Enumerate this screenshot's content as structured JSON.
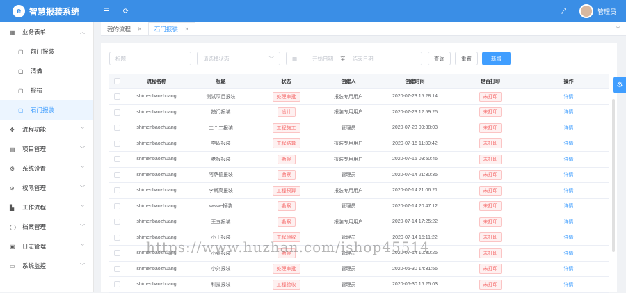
{
  "app": {
    "title": "智慧报装系统",
    "logo_letter": "e",
    "user_name": "管理员"
  },
  "topbar_icons": [
    "menu-icon",
    "refresh-icon",
    "fullscreen-icon"
  ],
  "sidebar": [
    {
      "label": "业务表单",
      "icon": "grid-icon",
      "expanded": true,
      "children": [
        {
          "label": "前门报装",
          "active": false
        },
        {
          "label": "清做",
          "active": false
        },
        {
          "label": "报损",
          "active": false
        },
        {
          "label": "石门报装",
          "active": true
        }
      ]
    },
    {
      "label": "流程功能",
      "icon": "flow-icon"
    },
    {
      "label": "项目管理",
      "icon": "project-icon"
    },
    {
      "label": "系统设置",
      "icon": "gear-icon"
    },
    {
      "label": "权限管理",
      "icon": "shield-icon"
    },
    {
      "label": "工作流程",
      "icon": "workflow-icon"
    },
    {
      "label": "档案管理",
      "icon": "archive-icon"
    },
    {
      "label": "日志管理",
      "icon": "log-icon"
    },
    {
      "label": "系统监控",
      "icon": "monitor-icon"
    }
  ],
  "tabs": [
    {
      "label": "我的流程",
      "active": false
    },
    {
      "label": "石门报装",
      "active": true
    }
  ],
  "filters": {
    "keyword_placeholder": "标题",
    "status_placeholder": "请选择状态",
    "date_start_placeholder": "开始日期",
    "date_sep": "至",
    "date_end_placeholder": "结束日期",
    "search_label": "查询",
    "reset_label": "重置",
    "add_label": "新增"
  },
  "table": {
    "headers": [
      "流程名称",
      "标题",
      "状态",
      "创建人",
      "创建时间",
      "是否打印",
      "操作"
    ],
    "rows": [
      {
        "flow": "shimenbaozhuang",
        "title": "测试项目报装",
        "status": "处理审批",
        "creator": "报装专用用户",
        "time": "2020-07-23 15:28:14",
        "print": "未打印",
        "op": "详情"
      },
      {
        "flow": "shimenbaozhuang",
        "title": "技门报装",
        "status": "设计",
        "creator": "报装专用用户",
        "time": "2020-07-23 12:59:25",
        "print": "未打印",
        "op": "详情"
      },
      {
        "flow": "shimenbaozhuang",
        "title": "工个二报装",
        "status": "工程施工",
        "creator": "管理员",
        "time": "2020-07-23 09:38:03",
        "print": "未打印",
        "op": "详情"
      },
      {
        "flow": "shimenbaozhuang",
        "title": "李四报装",
        "status": "工程结算",
        "creator": "报装专用用户",
        "time": "2020-07-15 11:30:42",
        "print": "未打印",
        "op": "详情"
      },
      {
        "flow": "shimenbaozhuang",
        "title": "老板报装",
        "status": "勘察",
        "creator": "报装专用用户",
        "time": "2020-07-15 09:50:46",
        "print": "未打印",
        "op": "详情"
      },
      {
        "flow": "shimenbaozhuang",
        "title": "阿萨德报装",
        "status": "勘察",
        "creator": "管理员",
        "time": "2020-07-14 21:30:35",
        "print": "未打印",
        "op": "详情"
      },
      {
        "flow": "shimenbaozhuang",
        "title": "李斯高报装",
        "status": "工程预算",
        "creator": "报装专用用户",
        "time": "2020-07-14 21:06:21",
        "print": "未打印",
        "op": "详情"
      },
      {
        "flow": "shimenbaozhuang",
        "title": "wwwe报装",
        "status": "勘察",
        "creator": "管理员",
        "time": "2020-07-14 20:47:12",
        "print": "未打印",
        "op": "详情"
      },
      {
        "flow": "shimenbaozhuang",
        "title": "王五报装",
        "status": "勘察",
        "creator": "报装专用用户",
        "time": "2020-07-14 17:25:22",
        "print": "未打印",
        "op": "详情"
      },
      {
        "flow": "shimenbaozhuang",
        "title": "小王报装",
        "status": "工程验收",
        "creator": "管理员",
        "time": "2020-07-14 15:11:22",
        "print": "未打印",
        "op": "详情"
      },
      {
        "flow": "shimenbaozhuang",
        "title": "小张报装",
        "status": "勘察",
        "creator": "管理员",
        "time": "2020-07-14 10:30:25",
        "print": "未打印",
        "op": "详情"
      },
      {
        "flow": "shimenbaozhuang",
        "title": "小刘报装",
        "status": "处理审批",
        "creator": "管理员",
        "time": "2020-06-30 14:31:56",
        "print": "未打印",
        "op": "详情"
      },
      {
        "flow": "shimenbaozhuang",
        "title": "科技报装",
        "status": "工程验收",
        "creator": "管理员",
        "time": "2020-06-30 16:25:03",
        "print": "未打印",
        "op": "详情"
      }
    ]
  },
  "watermark": "https://www.huzhan.com/ishop45514",
  "colors": {
    "primary": "#409eff",
    "topbar": "#3a8ee6",
    "danger": "#f56c6c"
  }
}
